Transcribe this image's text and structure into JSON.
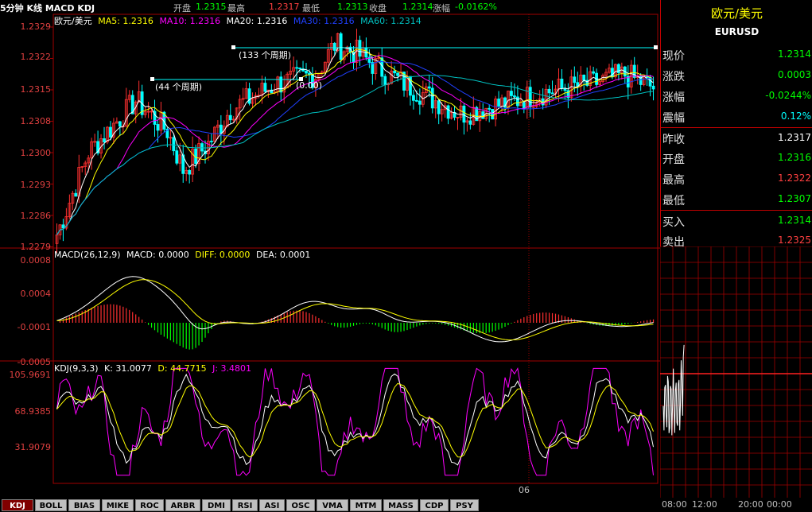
{
  "topbar": {
    "title": "5分钟 K线 MACD KDJ",
    "open_label": "开盘",
    "open_value": "1.2315",
    "high_label": "最高",
    "high_value": "1.2317",
    "low_label": "最低",
    "low_value": "1.2313",
    "close_label": "收盘",
    "close_value": "1.2314",
    "change_label": "涨幅",
    "change_value": "-0.0162%"
  },
  "price_panel": {
    "symbol": "欧元/美元",
    "ma5": "MA5: 1.2316",
    "ma10": "MA10: 1.2316",
    "ma20": "MA20: 1.2316",
    "ma30": "MA30: 1.2316",
    "ma60": "MA60: 1.2314",
    "y_labels": [
      "1.2329",
      "1.2322",
      "1.2315",
      "1.2308",
      "1.2300",
      "1.2293",
      "1.2286",
      "1.2279"
    ],
    "annot_133": "(133 个周期)",
    "annot_44": "(44 个周期)",
    "annot_zero": "(0.00)"
  },
  "macd_panel": {
    "legend_name": "MACD(26,12,9)",
    "legend_macd": "MACD: 0.0000",
    "legend_diff": "DIFF: 0.0000",
    "legend_dea": "DEA: 0.0001",
    "y_labels": [
      "0.0008",
      "0.0004",
      "-0.0001",
      "-0.0005"
    ]
  },
  "kdj_panel": {
    "legend_name": "KDJ(9,3,3)",
    "legend_k": "K: 31.0077",
    "legend_d": "D: 44.7715",
    "legend_j": "J: 3.4801",
    "y_labels": [
      "105.9691",
      "68.9385",
      "31.9079"
    ],
    "x_label": "06"
  },
  "tabs": [
    "KDJ",
    "BOLL",
    "BIAS",
    "MIKE",
    "ROC",
    "ARBR",
    "DMI",
    "RSI",
    "ASI",
    "OSC",
    "VMA",
    "MTM",
    "MASS",
    "CDP",
    "PSY"
  ],
  "info": {
    "name": "欧元/美元",
    "code": "EURUSD",
    "rows": [
      {
        "label": "现价",
        "value": "1.2314",
        "color": "#00ff00"
      },
      {
        "label": "涨跌",
        "value": "0.0003",
        "color": "#00ff00"
      },
      {
        "label": "涨幅",
        "value": "-0.0244%",
        "color": "#00ff00"
      },
      {
        "label": "震幅",
        "value": "0.12%",
        "color": "#00ffff"
      },
      {
        "label": "昨收",
        "value": "1.2317",
        "color": "#ffffff"
      },
      {
        "label": "开盘",
        "value": "1.2316",
        "color": "#00ff00"
      },
      {
        "label": "最高",
        "value": "1.2322",
        "color": "#ff4040"
      },
      {
        "label": "最低",
        "value": "1.2307",
        "color": "#00ff00"
      },
      {
        "label": "买入",
        "value": "1.2314",
        "color": "#00ff00"
      },
      {
        "label": "卖出",
        "value": "1.2325",
        "color": "#ff4040"
      }
    ]
  },
  "bottom_time": {
    "t1": "08:00",
    "t2": "12:00",
    "t3": "20:00",
    "t4": "00:00"
  },
  "colors": {
    "up": "#ff3030",
    "down": "#00ffff",
    "grid": "#a00000",
    "ma5": "#ffffff",
    "ma10": "#ffff00",
    "ma20": "#ff00ff",
    "ma30": "#2040ff",
    "ma60": "#00c0c0"
  }
}
